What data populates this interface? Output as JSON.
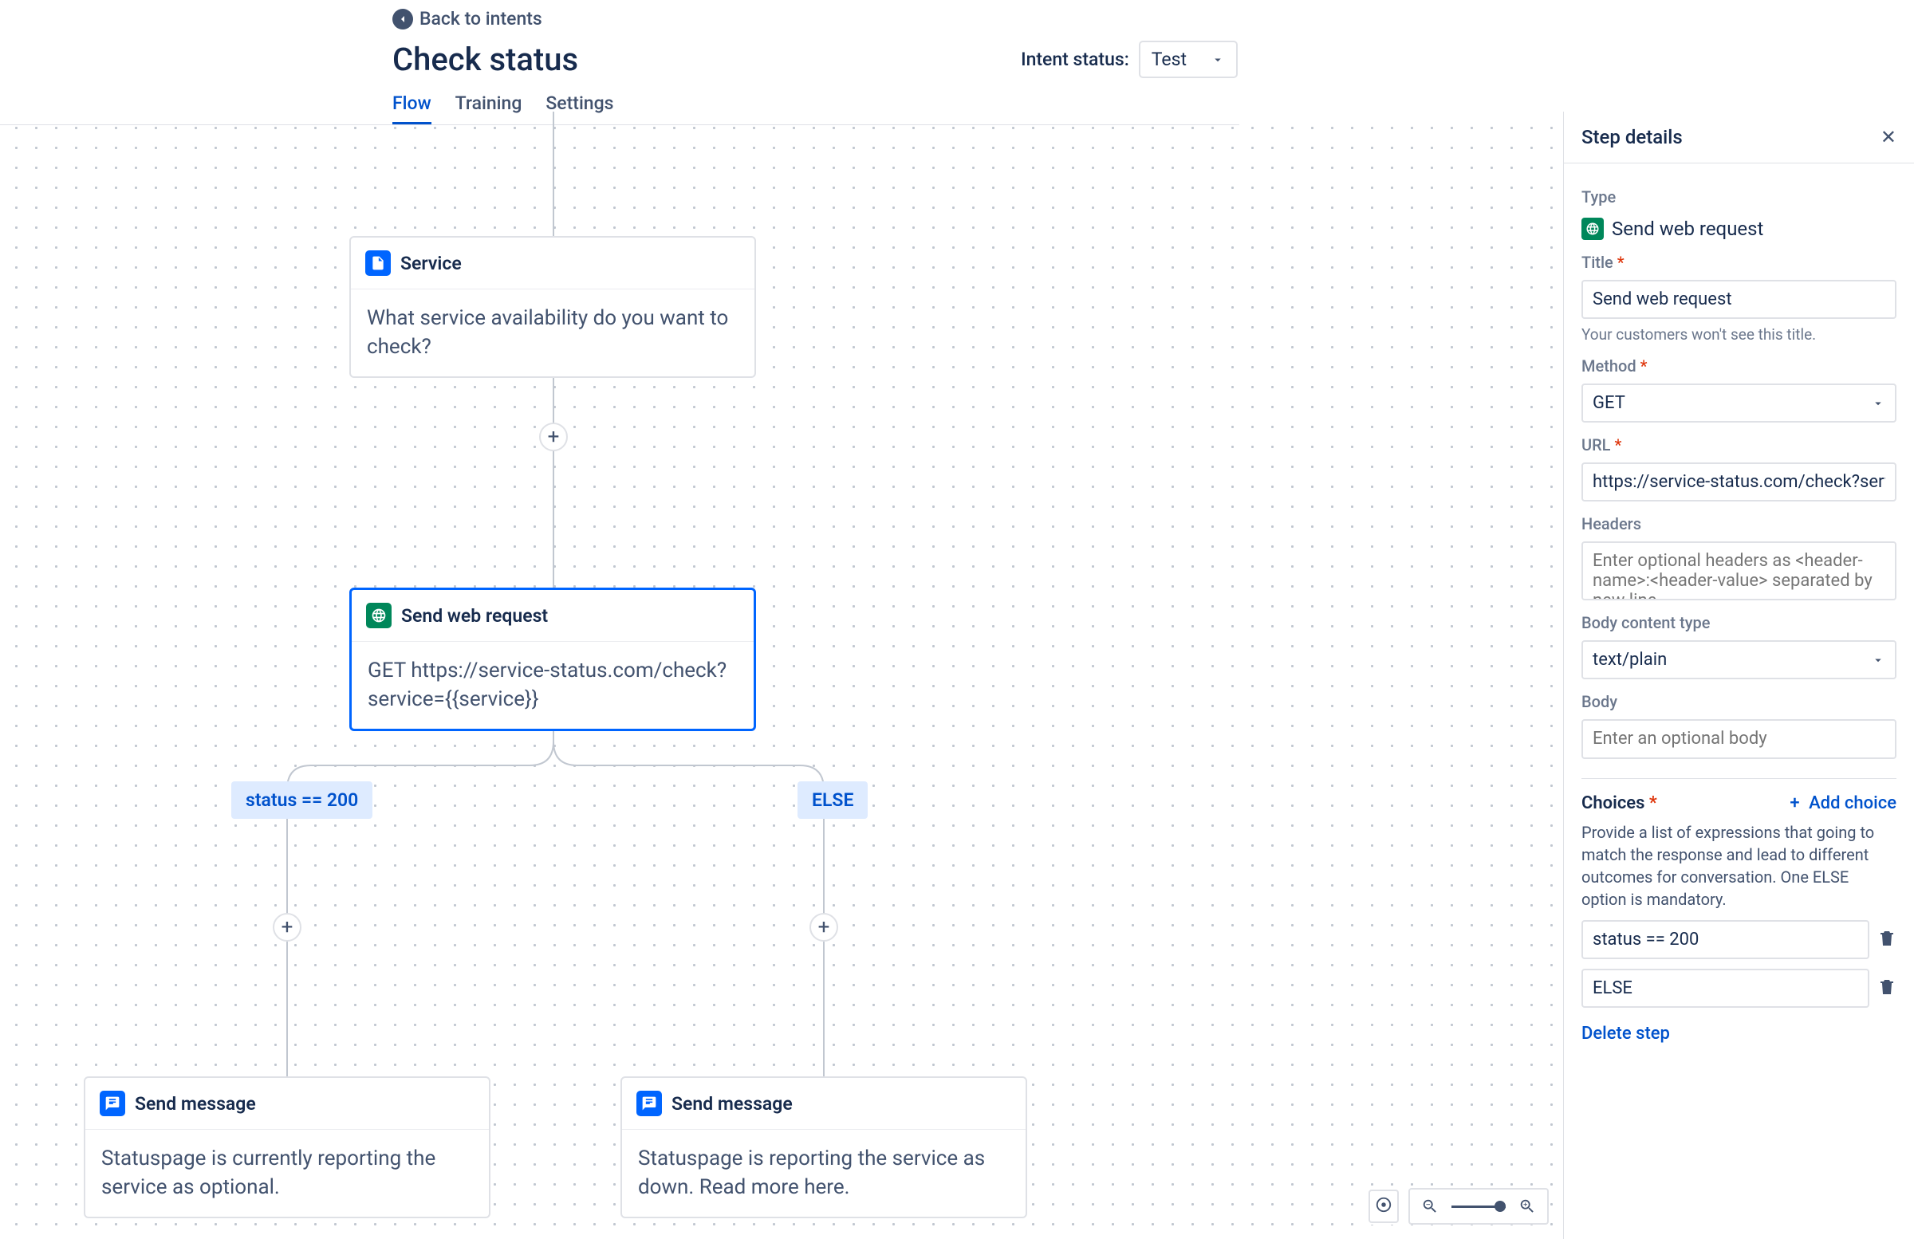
{
  "header": {
    "back_label": "Back to intents",
    "page_title": "Check status",
    "status_label": "Intent status:",
    "status_value": "Test",
    "tabs": [
      "Flow",
      "Training",
      "Settings"
    ],
    "active_tab": "Flow"
  },
  "flow": {
    "node_service": {
      "title": "Service",
      "body": "What service availability do you want to check?"
    },
    "node_webreq": {
      "title": "Send web request",
      "body": "GET https://service-status.com/check?service={{service}}"
    },
    "branch_left": "status == 200",
    "branch_right": "ELSE",
    "node_msg_left": {
      "title": "Send message",
      "body": "Statuspage is currently reporting the service as optional."
    },
    "node_msg_right": {
      "title": "Send message",
      "body": "Statuspage is reporting the service as down. Read more here."
    }
  },
  "panel": {
    "title": "Step details",
    "labels": {
      "type": "Type",
      "title": "Title",
      "method": "Method",
      "url": "URL",
      "headers": "Headers",
      "body_type": "Body content type",
      "body": "Body",
      "choices": "Choices",
      "add_choice": "Add choice",
      "delete_step": "Delete step"
    },
    "type_value": "Send web request",
    "title_value": "Send web request",
    "title_helper": "Your customers won't see this title.",
    "method_value": "GET",
    "url_value": "https://service-status.com/check?service={{service}}",
    "headers_placeholder": "Enter optional headers as <header-name>:<header-value> separated by new line",
    "body_type_value": "text/plain",
    "body_placeholder": "Enter an optional body",
    "choices_desc": "Provide a list of expressions that going to match the response and lead to different outcomes for conversation. One ELSE option is mandatory.",
    "choices": [
      "status == 200",
      "ELSE"
    ]
  }
}
